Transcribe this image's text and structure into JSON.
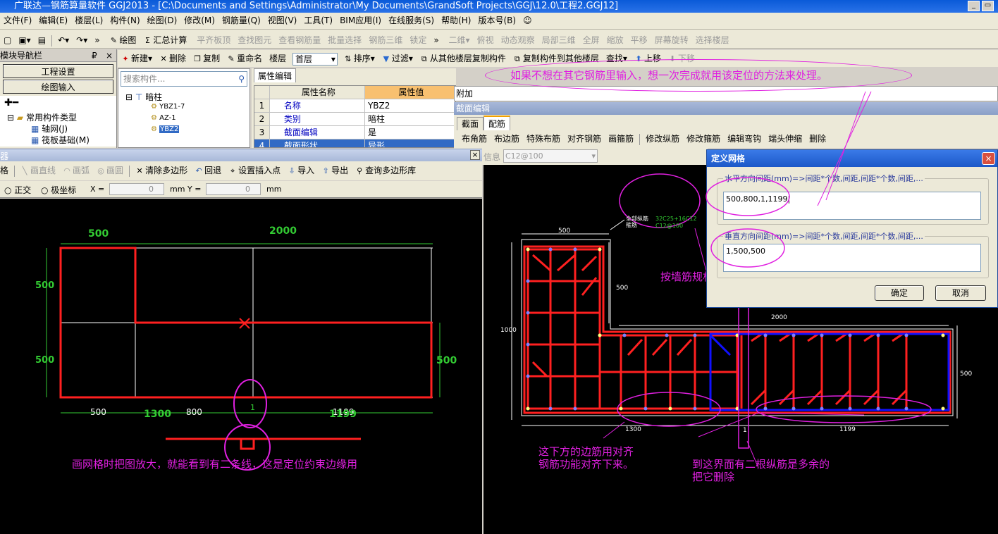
{
  "title": "广联达—钢筋算量软件 GGJ2013 - [C:\\Documents and Settings\\Administrator\\My Documents\\GrandSoft Projects\\GGJ\\12.0\\工程2.GGJ12]",
  "menu": [
    "文件(F)",
    "编辑(E)",
    "楼层(L)",
    "构件(N)",
    "绘图(D)",
    "修改(M)",
    "钢筋量(Q)",
    "视图(V)",
    "工具(T)",
    "BIM应用(I)",
    "在线服务(S)",
    "帮助(H)",
    "版本号(B)"
  ],
  "toolbar1": {
    "draw": "绘图",
    "sum": "汇总计算",
    "flush": "平齐板顶",
    "find": "查找图元",
    "view_rebar": "查看钢筋量",
    "batch": "批量选择",
    "rebar3d": "钢筋三维",
    "lock": "锁定",
    "view2d": "二维",
    "top": "俯视",
    "dynamic": "动态观察",
    "local3d": "局部三维",
    "full": "全屏",
    "zoom": "缩放",
    "pan": "平移",
    "rotate": "屏幕旋转",
    "select_layer": "选择楼层"
  },
  "nav": {
    "title": "模块导航栏",
    "pin": "₽",
    "close": "×",
    "project": "工程设置",
    "draw_input": "绘图输入",
    "tree_root": "常用构件类型",
    "tree_items": [
      "轴网(J)",
      "筏板基础(M)"
    ]
  },
  "toolbar2": {
    "new": "新建",
    "delete": "删除",
    "copy": "复制",
    "rename": "重命名",
    "floor_label": "楼层",
    "floor": "首层",
    "sort": "排序",
    "filter": "过滤",
    "copy_from": "从其他楼层复制构件",
    "copy_to": "复制构件到其他楼层",
    "find": "查找",
    "up": "上移",
    "down": "下移"
  },
  "search": {
    "placeholder": "搜索构件..."
  },
  "tree": {
    "root": "暗柱",
    "items": [
      "YBZ1-7",
      "AZ-1",
      "YBZ2"
    ]
  },
  "props": {
    "tab": "属性编辑",
    "col_name": "属性名称",
    "col_value": "属性值",
    "rows": [
      {
        "n": "1",
        "name": "名称",
        "value": "YBZ2"
      },
      {
        "n": "2",
        "name": "类别",
        "value": "暗柱"
      },
      {
        "n": "3",
        "name": "截面编辑",
        "value": "是"
      },
      {
        "n": "4",
        "name": "截面形状",
        "value": "异形"
      }
    ],
    "extra": "附加"
  },
  "section": {
    "title": "截面编辑",
    "tab1": "截面",
    "tab2": "配筋",
    "tools": [
      "布角筋",
      "布边筋",
      "特殊布筋",
      "对齐钢筋",
      "画箍筋",
      "修改纵筋",
      "修改箍筋",
      "编辑弯钩",
      "端头伸缩",
      "删除"
    ],
    "info_label": "信息",
    "info_value": "C12@100"
  },
  "poly_editor": {
    "close": "×",
    "tools": {
      "grid": "格",
      "line": "画直线",
      "arc": "画弧",
      "circle": "画圆",
      "clear": "清除多边形",
      "undo": "回退",
      "insert": "设置插入点",
      "import": "导入",
      "export": "导出",
      "library": "查询多边形库"
    },
    "ortho": "正交",
    "polar": "极坐标",
    "x_label": "X =",
    "x_value": "0",
    "y_label": "Y =",
    "y_value": "0",
    "unit": "mm"
  },
  "left_dims": {
    "top1": "500",
    "top2": "2000",
    "left_a": "500",
    "left_b": "500",
    "right": "500",
    "bot1": "500",
    "bot2": "800",
    "bot3": "1199",
    "bot_green1": "1300",
    "bot_green2": "1199",
    "one": "1"
  },
  "grid_dialog": {
    "title": "定义网格",
    "close": "×",
    "h_label": "水平方向间距(mm)=>间距*个数,间距,间距*个数,间距,...",
    "h_value": "500,800,1,1199",
    "v_label": "垂直方向间距(mm)=>间距*个数,间距,间距*个数,间距,...",
    "v_value": "1,500,500",
    "ok": "确定",
    "cancel": "取消"
  },
  "right_dims": {
    "d500a": "500",
    "d500b": "500",
    "d1000": "1000",
    "d2000": "2000",
    "d500c": "500",
    "d1300": "1300",
    "d1199": "1199",
    "one": "1"
  },
  "rebar_label": {
    "line1": "全部纵筋",
    "line2": "箍筋",
    "spec1": "32C25+16C12",
    "spec2": "C12@100"
  },
  "annotations": {
    "top": "如果不想在其它钢筋里输入，想一次完成就用该定位的方法来处理。",
    "wall": "按墙筋规格输入",
    "left_bottom": "画网格时把图放大，就能看到有二条线，这是定位约束边缘用",
    "align1": "这下方的边筋用对齐",
    "align2": "钢筋功能对齐下来。",
    "extra1": "到这界面有二根纵筋是多余的",
    "extra2": "把它删除"
  },
  "colors": {
    "accent": "#e020e0",
    "shape": "#ff0000",
    "dim": "#33cc33",
    "stirrup": "#0000ff"
  }
}
